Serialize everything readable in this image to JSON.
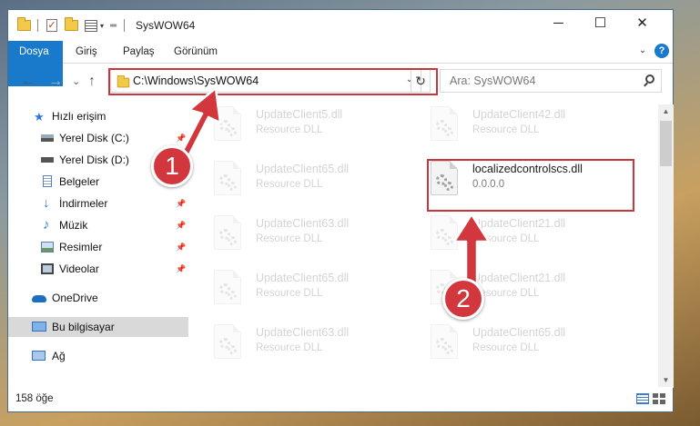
{
  "window": {
    "title": "SysWOW64",
    "controls": {
      "minimize": "─",
      "maximize": "☐",
      "close": "✕"
    }
  },
  "quick_access_toolbar": {
    "dropdown_glyph": "▾",
    "customize_glyph": "═"
  },
  "ribbon": {
    "tabs": [
      "Dosya",
      "Giriş",
      "Paylaş",
      "Görünüm"
    ],
    "expand_glyph": "⌄",
    "help_glyph": "?"
  },
  "nav": {
    "back": "←",
    "forward": "→",
    "recent": "⌄",
    "up": "↑"
  },
  "address_bar": {
    "path": "C:\\Windows\\SysWOW64",
    "dropdown_glyph": "⌄",
    "refresh_glyph": "↻"
  },
  "search": {
    "placeholder": "Ara: SysWOW64"
  },
  "sidebar": {
    "pin_glyph": "📌",
    "items": [
      {
        "label": "Hızlı erişim",
        "icon": "star-icon",
        "pinned": false
      },
      {
        "label": "Yerel Disk (C:)",
        "icon": "drive-icon",
        "pinned": true
      },
      {
        "label": "Yerel Disk (D:)",
        "icon": "drive-icon",
        "pinned": true
      },
      {
        "label": "Belgeler",
        "icon": "documents-icon",
        "pinned": true
      },
      {
        "label": "İndirmeler",
        "icon": "download-icon",
        "pinned": true
      },
      {
        "label": "Müzik",
        "icon": "music-icon",
        "pinned": true
      },
      {
        "label": "Resimler",
        "icon": "pictures-icon",
        "pinned": true
      },
      {
        "label": "Videolar",
        "icon": "video-icon",
        "pinned": true
      },
      {
        "label": "OneDrive",
        "icon": "cloud-icon",
        "pinned": false
      },
      {
        "label": "Bu bilgisayar",
        "icon": "computer-icon",
        "pinned": false,
        "selected": true
      },
      {
        "label": "Ağ",
        "icon": "network-icon",
        "pinned": false
      }
    ]
  },
  "files": [
    {
      "name": "UpdateClient5.dll",
      "type": "Resource DLL",
      "faded": true
    },
    {
      "name": "UpdateClient42.dll",
      "type": "Resource DLL",
      "faded": true
    },
    {
      "name": "UpdateClient65.dll",
      "type": "Resource DLL",
      "faded": true
    },
    {
      "name": "localizedcontrolscs.dll",
      "type": "0.0.0.0",
      "faded": false
    },
    {
      "name": "UpdateClient63.dll",
      "type": "Resource DLL",
      "faded": true
    },
    {
      "name": "UpdateClient21.dll",
      "type": "Resource DLL",
      "faded": true
    },
    {
      "name": "UpdateClient65.dll",
      "type": "Resource DLL",
      "faded": true
    },
    {
      "name": "UpdateClient21.dll",
      "type": "Resource DLL",
      "faded": true
    },
    {
      "name": "UpdateClient63.dll",
      "type": "Resource DLL",
      "faded": true
    },
    {
      "name": "UpdateClient65.dll",
      "type": "Resource DLL",
      "faded": true
    }
  ],
  "status_bar": {
    "item_count": "158 öğe"
  },
  "scrollbar": {
    "up_glyph": "▲",
    "down_glyph": "▼"
  },
  "annotations": {
    "step1": "1",
    "step2": "2",
    "highlight_color": "#c8353b",
    "badge_color": "#d3373e"
  },
  "colors": {
    "accent": "#1979ca",
    "selection": "#d9d9d9"
  }
}
